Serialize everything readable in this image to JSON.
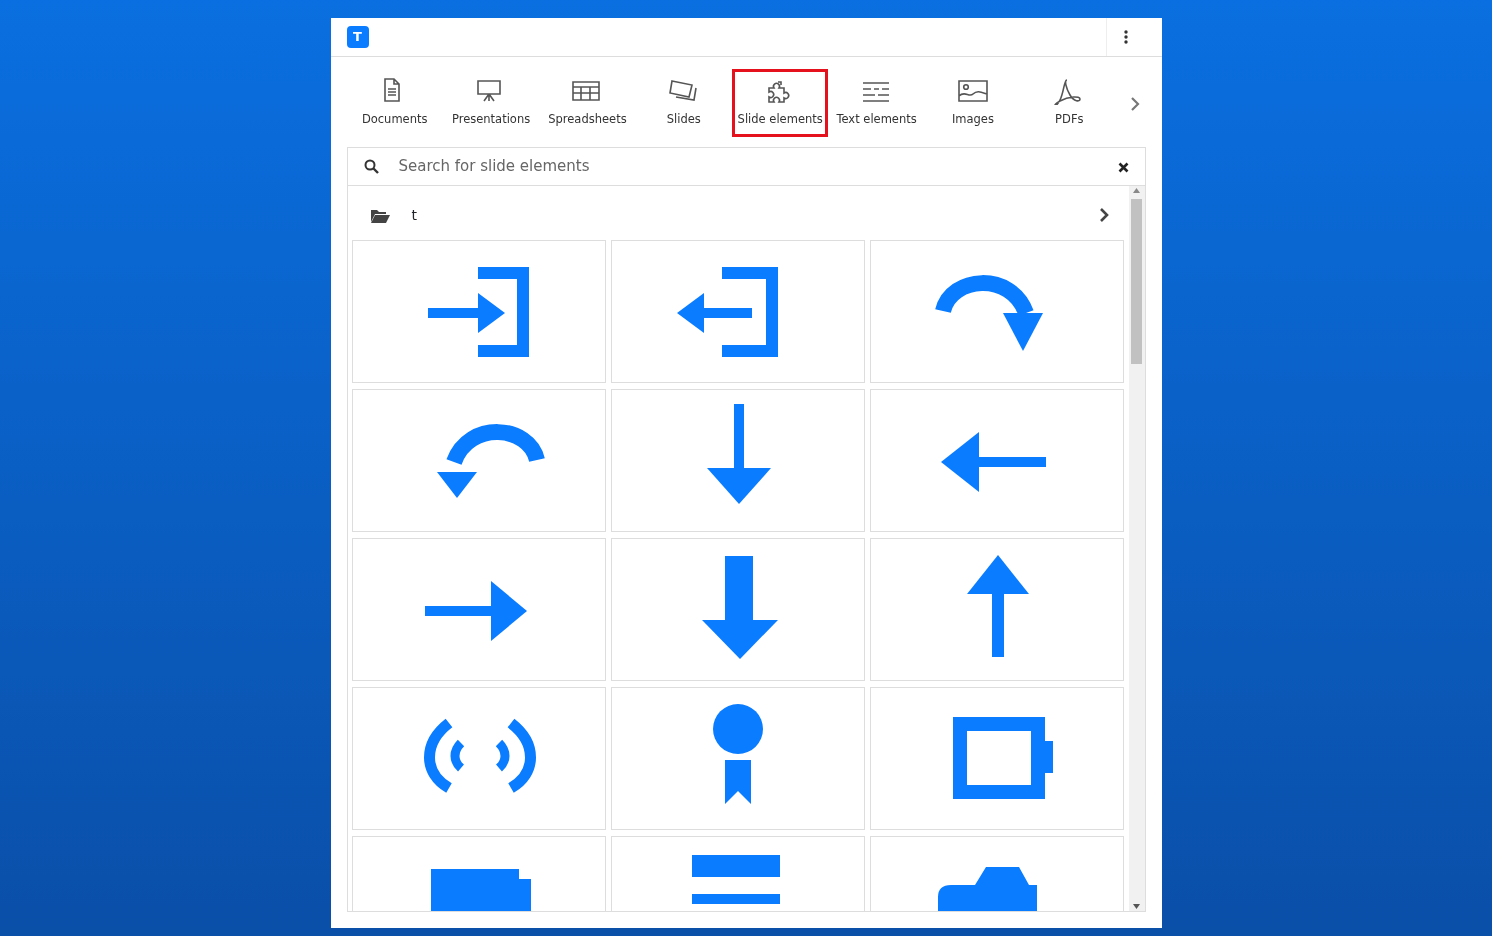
{
  "app": {
    "logo": "T"
  },
  "tabs": [
    {
      "label": "Documents",
      "selected": false
    },
    {
      "label": "Presentations",
      "selected": false
    },
    {
      "label": "Spreadsheets",
      "selected": false
    },
    {
      "label": "Slides",
      "selected": false
    },
    {
      "label": "Slide elements",
      "selected": true
    },
    {
      "label": "Text elements",
      "selected": false
    },
    {
      "label": "Images",
      "selected": false
    },
    {
      "label": "PDFs",
      "selected": false
    }
  ],
  "search": {
    "placeholder": "Search for slide elements"
  },
  "folder": {
    "name": "t"
  },
  "tiles": [
    {
      "kind": "enter"
    },
    {
      "kind": "exit"
    },
    {
      "kind": "redo"
    },
    {
      "kind": "undo"
    },
    {
      "kind": "down-thin"
    },
    {
      "kind": "left"
    },
    {
      "kind": "right"
    },
    {
      "kind": "down-thick"
    },
    {
      "kind": "up"
    },
    {
      "kind": "broadcast"
    },
    {
      "kind": "award"
    },
    {
      "kind": "battery"
    },
    {
      "kind": "folder"
    },
    {
      "kind": "stripes"
    },
    {
      "kind": "camera"
    }
  ]
}
